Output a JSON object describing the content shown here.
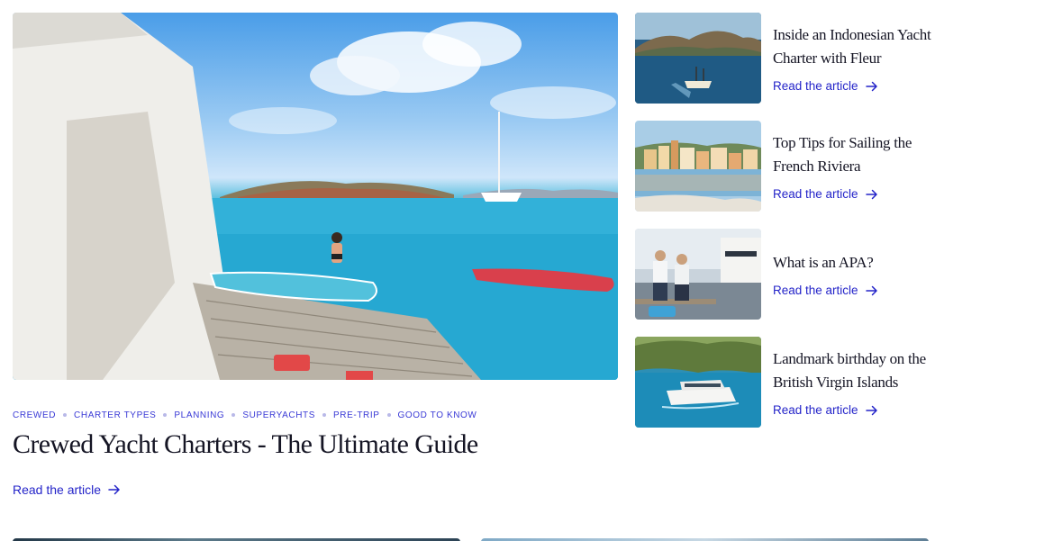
{
  "featured": {
    "tags": [
      "CREWED",
      "CHARTER TYPES",
      "PLANNING",
      "SUPERYACHTS",
      "PRE-TRIP",
      "GOOD TO KNOW"
    ],
    "title": "Crewed Yacht Charters - The Ultimate Guide",
    "link_label": "Read the article",
    "image": "yacht-deck-sea-photo"
  },
  "side_articles": [
    {
      "title": "Inside an Indonesian Yacht Charter with Fleur",
      "link_label": "Read the article",
      "image": "indonesian-bay-boat-photo"
    },
    {
      "title": "Top Tips for Sailing the French Riviera",
      "link_label": "Read the article",
      "image": "riviera-town-photo"
    },
    {
      "title": "What is an APA?",
      "link_label": "Read the article",
      "image": "marina-crew-photo"
    },
    {
      "title": "Landmark birthday on the British Virgin Islands",
      "link_label": "Read the article",
      "image": "catamaran-island-photo"
    }
  ],
  "icons": {
    "link_arrow": "arrow-right-icon"
  },
  "colors": {
    "accent": "#2424c9",
    "tag": "#3a3ad6",
    "title": "#151524"
  }
}
